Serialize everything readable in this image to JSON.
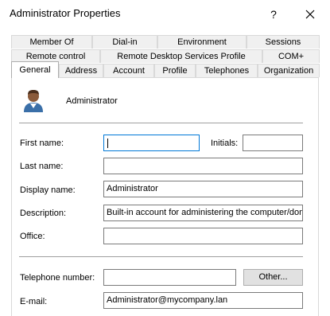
{
  "window": {
    "title": "Administrator Properties",
    "help_glyph": "?"
  },
  "tabs": {
    "row1": [
      "Member Of",
      "Dial-in",
      "Environment",
      "Sessions"
    ],
    "row2": [
      "Remote control",
      "Remote Desktop Services Profile",
      "COM+"
    ],
    "row3": [
      "General",
      "Address",
      "Account",
      "Profile",
      "Telephones",
      "Organization"
    ],
    "active": "General"
  },
  "general": {
    "display_header": "Administrator",
    "first_name_label": "First name:",
    "first_name_value": "",
    "initials_label": "Initials:",
    "initials_value": "",
    "last_name_label": "Last name:",
    "last_name_value": "",
    "display_name_label": "Display name:",
    "display_name_value": "Administrator",
    "description_label": "Description:",
    "description_value": "Built-in account for administering the computer/doma",
    "office_label": "Office:",
    "office_value": "",
    "telephone_label": "Telephone number:",
    "telephone_value": "",
    "other_button": "Other...",
    "email_label": "E-mail:",
    "email_value": "Administrator@mycompany.lan"
  },
  "icons": {
    "avatar": "user-avatar-icon",
    "close": "close-icon"
  }
}
